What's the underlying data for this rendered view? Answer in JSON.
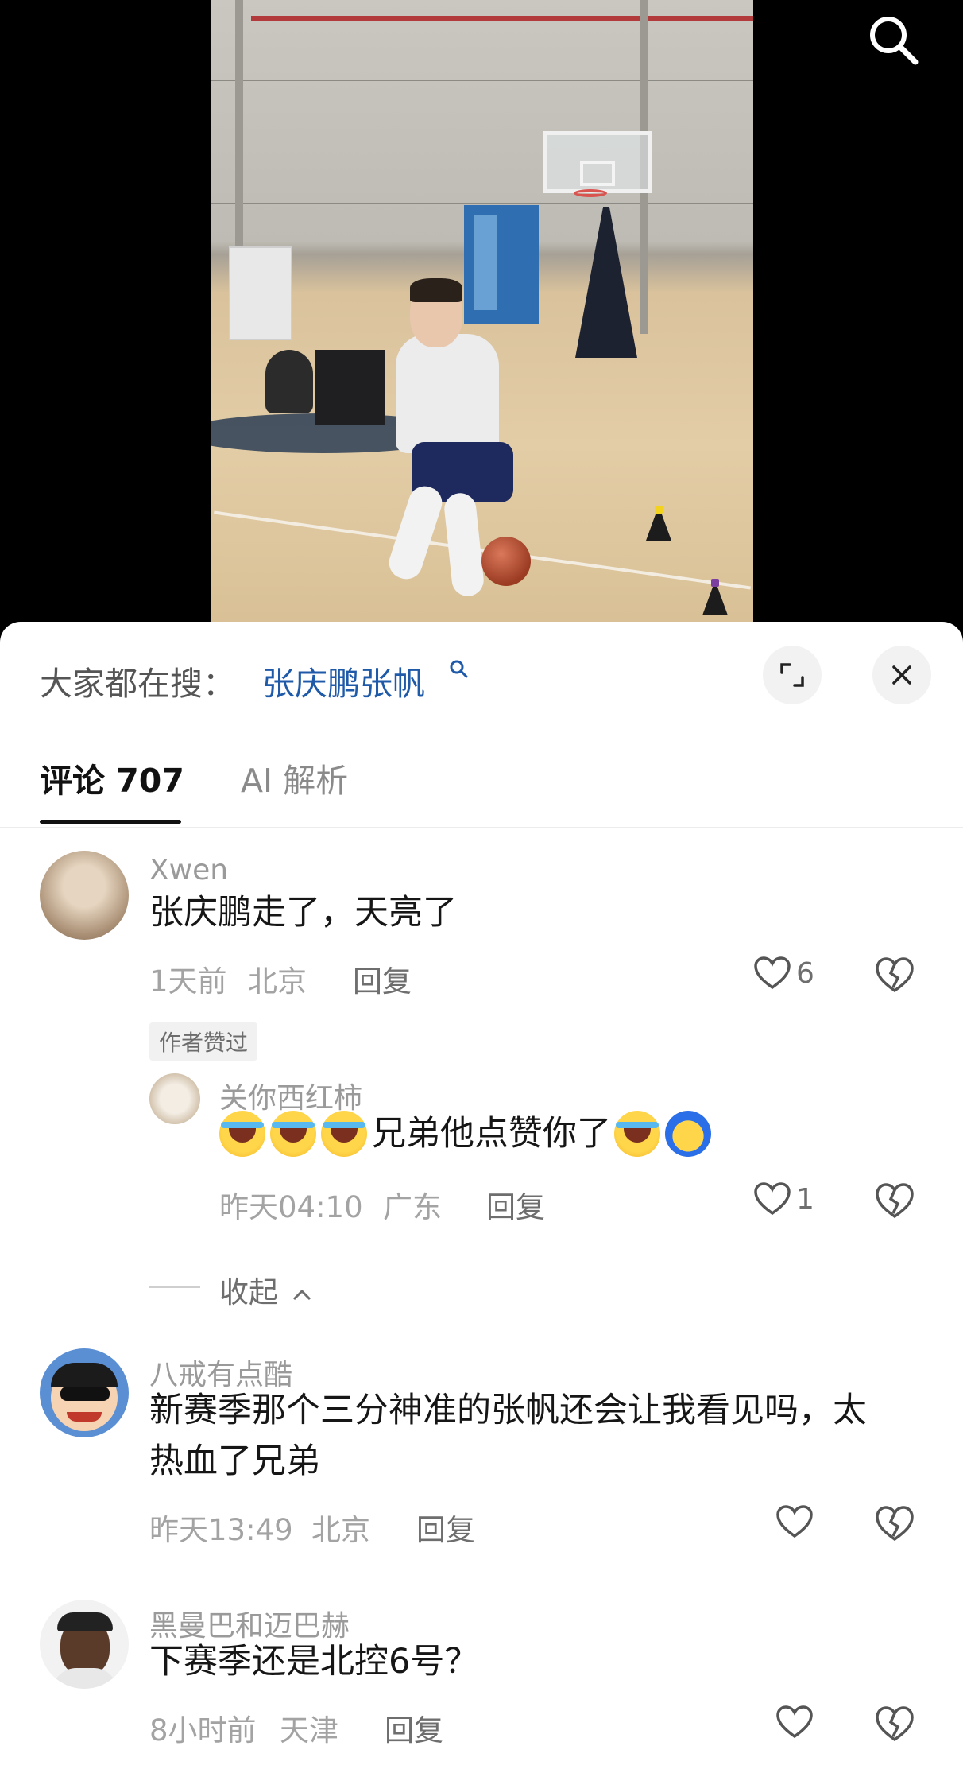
{
  "video": {
    "search_icon": "search-icon"
  },
  "panel": {
    "search_prefix": "大家都在搜：",
    "search_term": "张庆鹏张帆",
    "expand_icon": "expand-icon",
    "close_icon": "close-icon"
  },
  "tabs": {
    "comments_label": "评论 707",
    "ai_label": "AI 解析"
  },
  "comments": [
    {
      "username": "Xwen",
      "text": "张庆鹏走了，天亮了",
      "time": "1天前",
      "location": "北京",
      "reply_label": "回复",
      "likes": "6",
      "badge": "作者赞过"
    },
    {
      "username": "八戒有点酷",
      "text_line1": "新赛季那个三分神准的张帆还会让我看见吗，太",
      "text_line2": "热血了兄弟",
      "time": "昨天13:49",
      "location": "北京",
      "reply_label": "回复"
    },
    {
      "username": "黑曼巴和迈巴赫",
      "text": "下赛季还是北控6号？",
      "time": "8小时前",
      "location": "天津",
      "reply_label": "回复"
    }
  ],
  "reply": {
    "username": "关你西红柿",
    "text": "兄弟他点赞你了",
    "time": "昨天04:10",
    "location": "广东",
    "reply_label": "回复",
    "likes": "1",
    "collapse_label": "收起"
  },
  "colors": {
    "accent_link": "#1f5aa8",
    "text_primary": "#161616",
    "text_muted": "#a3a3a3"
  }
}
